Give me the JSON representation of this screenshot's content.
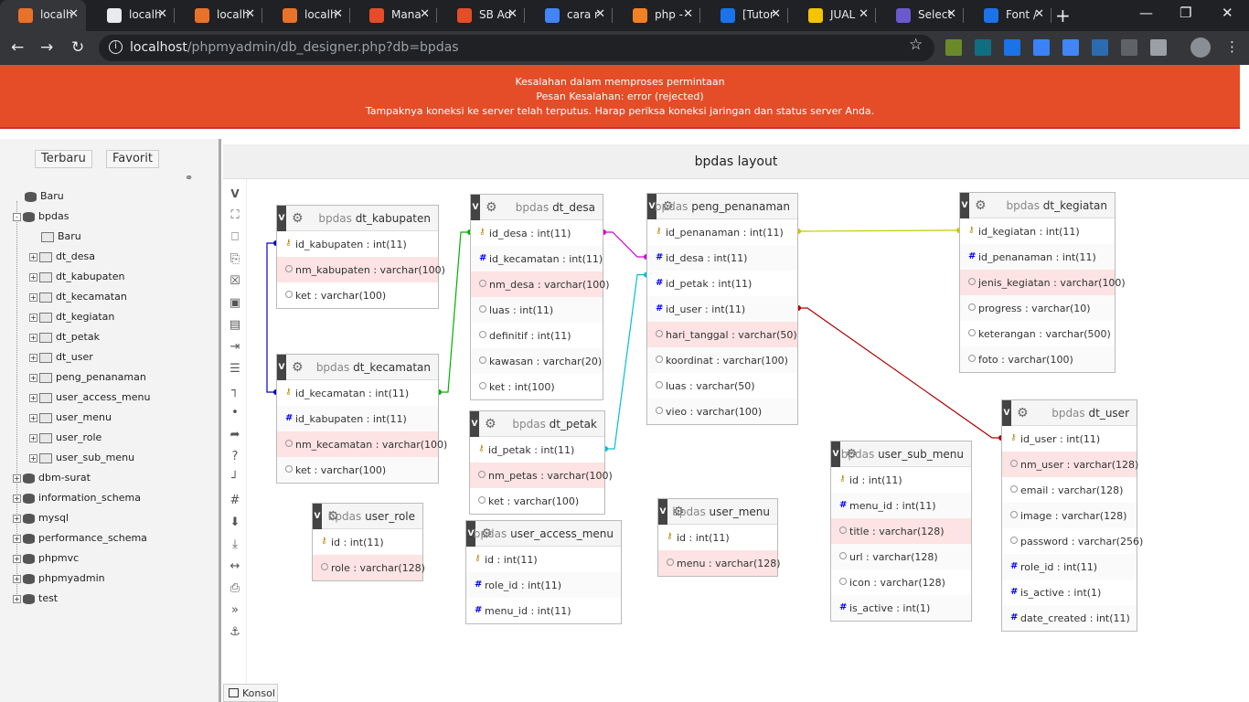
{
  "browser": {
    "tabs": [
      {
        "title": "localh",
        "icon": "phpmyadmin-icon",
        "active": true,
        "color": "#e8722a"
      },
      {
        "title": "localh",
        "icon": "loading-icon",
        "active": false,
        "color": "#e8eaed"
      },
      {
        "title": "localh",
        "icon": "phpmyadmin-icon",
        "active": false,
        "color": "#e8722a"
      },
      {
        "title": "localh",
        "icon": "phpmyadmin-icon",
        "active": false,
        "color": "#e8722a"
      },
      {
        "title": "Mana",
        "icon": "codeigniter-icon",
        "active": false,
        "color": "#e44d27"
      },
      {
        "title": "SB Ad",
        "icon": "codeigniter-icon",
        "active": false,
        "color": "#e44d27"
      },
      {
        "title": "cara r",
        "icon": "google-icon",
        "active": false,
        "color": "#4285f4"
      },
      {
        "title": "php -",
        "icon": "stackoverflow-icon",
        "active": false,
        "color": "#f48024"
      },
      {
        "title": "[Tutor",
        "icon": "tutorial-icon",
        "active": false,
        "color": "#1a73e8"
      },
      {
        "title": "JUAL",
        "icon": "hnd-icon",
        "active": false,
        "color": "#f5c400"
      },
      {
        "title": "Select",
        "icon": "select-icon",
        "active": false,
        "color": "#6a5acd"
      },
      {
        "title": "Font /",
        "icon": "flag-icon",
        "active": false,
        "color": "#1a73e8"
      }
    ],
    "url_host": "localhost",
    "url_path": "/phpmyadmin/db_designer.php?db=bpdas"
  },
  "error": {
    "line1": "Kesalahan dalam memproses permintaan",
    "line2": "Pesan Kesalahan: error (rejected)",
    "line3": "Tampaknya koneksi ke server telah terputus. Harap periksa koneksi jaringan dan status server Anda."
  },
  "leftpane": {
    "recent_label": "Terbaru",
    "favorite_label": "Favorit",
    "tree": [
      {
        "label": "Baru",
        "kind": "db",
        "indent": 0,
        "toggle": ""
      },
      {
        "label": "bpdas",
        "kind": "db",
        "indent": 0,
        "toggle": "-"
      },
      {
        "label": "Baru",
        "kind": "new",
        "indent": 1,
        "toggle": ""
      },
      {
        "label": "dt_desa",
        "kind": "table",
        "indent": 1,
        "toggle": "+"
      },
      {
        "label": "dt_kabupaten",
        "kind": "table",
        "indent": 1,
        "toggle": "+"
      },
      {
        "label": "dt_kecamatan",
        "kind": "table",
        "indent": 1,
        "toggle": "+"
      },
      {
        "label": "dt_kegiatan",
        "kind": "table",
        "indent": 1,
        "toggle": "+"
      },
      {
        "label": "dt_petak",
        "kind": "table",
        "indent": 1,
        "toggle": "+"
      },
      {
        "label": "dt_user",
        "kind": "table",
        "indent": 1,
        "toggle": "+"
      },
      {
        "label": "peng_penanaman",
        "kind": "table",
        "indent": 1,
        "toggle": "+"
      },
      {
        "label": "user_access_menu",
        "kind": "table",
        "indent": 1,
        "toggle": "+"
      },
      {
        "label": "user_menu",
        "kind": "table",
        "indent": 1,
        "toggle": "+"
      },
      {
        "label": "user_role",
        "kind": "table",
        "indent": 1,
        "toggle": "+"
      },
      {
        "label": "user_sub_menu",
        "kind": "table",
        "indent": 1,
        "toggle": "+"
      },
      {
        "label": "dbm-surat",
        "kind": "db",
        "indent": 0,
        "toggle": "+"
      },
      {
        "label": "information_schema",
        "kind": "db",
        "indent": 0,
        "toggle": "+"
      },
      {
        "label": "mysql",
        "kind": "db",
        "indent": 0,
        "toggle": "+"
      },
      {
        "label": "performance_schema",
        "kind": "db",
        "indent": 0,
        "toggle": "+"
      },
      {
        "label": "phpmvc",
        "kind": "db",
        "indent": 0,
        "toggle": "+"
      },
      {
        "label": "phpmyadmin",
        "kind": "db",
        "indent": 0,
        "toggle": "+"
      },
      {
        "label": "test",
        "kind": "db",
        "indent": 0,
        "toggle": "+"
      }
    ]
  },
  "designer": {
    "title": "bpdas layout",
    "toggle_label": "V",
    "console_label": "Konsol",
    "tables": [
      {
        "id": "dt_kabupaten",
        "db": "bpdas",
        "name": "dt_kabupaten",
        "cols": [
          {
            "t": "id_kabupaten : int(11)",
            "k": "key"
          },
          {
            "t": "nm_kabupaten : varchar(100)",
            "k": "text",
            "hl": true
          },
          {
            "t": "ket : varchar(100)",
            "k": "text"
          }
        ]
      },
      {
        "id": "dt_kecamatan",
        "db": "bpdas",
        "name": "dt_kecamatan",
        "cols": [
          {
            "t": "id_kecamatan : int(11)",
            "k": "key"
          },
          {
            "t": "id_kabupaten : int(11)",
            "k": "num"
          },
          {
            "t": "nm_kecamatan : varchar(100)",
            "k": "text",
            "hl": true
          },
          {
            "t": "ket : varchar(100)",
            "k": "text"
          }
        ]
      },
      {
        "id": "user_role",
        "db": "bpdas",
        "name": "user_role",
        "cols": [
          {
            "t": "id : int(11)",
            "k": "key"
          },
          {
            "t": "role : varchar(128)",
            "k": "text",
            "hl": true
          }
        ]
      },
      {
        "id": "dt_desa",
        "db": "bpdas",
        "name": "dt_desa",
        "cols": [
          {
            "t": "id_desa : int(11)",
            "k": "key"
          },
          {
            "t": "id_kecamatan : int(11)",
            "k": "num"
          },
          {
            "t": "nm_desa : varchar(100)",
            "k": "text",
            "hl": true
          },
          {
            "t": "luas : int(11)",
            "k": "text"
          },
          {
            "t": "definitif : int(11)",
            "k": "text"
          },
          {
            "t": "kawasan : varchar(20)",
            "k": "text"
          },
          {
            "t": "ket : int(100)",
            "k": "text"
          }
        ]
      },
      {
        "id": "dt_petak",
        "db": "bpdas",
        "name": "dt_petak",
        "cols": [
          {
            "t": "id_petak : int(11)",
            "k": "key"
          },
          {
            "t": "nm_petas : varchar(100)",
            "k": "text",
            "hl": true
          },
          {
            "t": "ket : varchar(100)",
            "k": "text"
          }
        ]
      },
      {
        "id": "user_access_menu",
        "db": "bpdas",
        "name": "user_access_menu",
        "cols": [
          {
            "t": "id : int(11)",
            "k": "key"
          },
          {
            "t": "role_id : int(11)",
            "k": "num"
          },
          {
            "t": "menu_id : int(11)",
            "k": "num"
          }
        ]
      },
      {
        "id": "peng_penanaman",
        "db": "bpdas",
        "name": "peng_penanaman",
        "cols": [
          {
            "t": "id_penanaman : int(11)",
            "k": "key"
          },
          {
            "t": "id_desa : int(11)",
            "k": "num"
          },
          {
            "t": "id_petak : int(11)",
            "k": "num"
          },
          {
            "t": "id_user : int(11)",
            "k": "num"
          },
          {
            "t": "hari_tanggal : varchar(50)",
            "k": "text",
            "hl": true
          },
          {
            "t": "koordinat : varchar(100)",
            "k": "text"
          },
          {
            "t": "luas : varchar(50)",
            "k": "text"
          },
          {
            "t": "vieo : varchar(100)",
            "k": "text"
          }
        ]
      },
      {
        "id": "user_menu",
        "db": "bpdas",
        "name": "user_menu",
        "cols": [
          {
            "t": "id : int(11)",
            "k": "key"
          },
          {
            "t": "menu : varchar(128)",
            "k": "text",
            "hl": true
          }
        ]
      },
      {
        "id": "user_sub_menu",
        "db": "bpdas",
        "name": "user_sub_menu",
        "cols": [
          {
            "t": "id : int(11)",
            "k": "key"
          },
          {
            "t": "menu_id : int(11)",
            "k": "num"
          },
          {
            "t": "title : varchar(128)",
            "k": "text",
            "hl": true
          },
          {
            "t": "url : varchar(128)",
            "k": "text"
          },
          {
            "t": "icon : varchar(128)",
            "k": "text"
          },
          {
            "t": "is_active : int(1)",
            "k": "num"
          }
        ]
      },
      {
        "id": "dt_kegiatan",
        "db": "bpdas",
        "name": "dt_kegiatan",
        "cols": [
          {
            "t": "id_kegiatan : int(11)",
            "k": "key"
          },
          {
            "t": "id_penanaman : int(11)",
            "k": "num"
          },
          {
            "t": "jenis_kegiatan : varchar(100)",
            "k": "text",
            "hl": true
          },
          {
            "t": "progress : varchar(10)",
            "k": "text"
          },
          {
            "t": "keterangan : varchar(500)",
            "k": "text"
          },
          {
            "t": "foto : varchar(100)",
            "k": "text"
          }
        ]
      },
      {
        "id": "dt_user",
        "db": "bpdas",
        "name": "dt_user",
        "cols": [
          {
            "t": "id_user : int(11)",
            "k": "key"
          },
          {
            "t": "nm_user : varchar(128)",
            "k": "text",
            "hl": true
          },
          {
            "t": "email : varchar(128)",
            "k": "text"
          },
          {
            "t": "image : varchar(128)",
            "k": "text"
          },
          {
            "t": "password : varchar(256)",
            "k": "text"
          },
          {
            "t": "role_id : int(11)",
            "k": "num"
          },
          {
            "t": "is_active : int(1)",
            "k": "num"
          },
          {
            "t": "date_created : int(11)",
            "k": "num"
          }
        ]
      }
    ],
    "relations": [
      {
        "from": "dt_kecamatan",
        "to": "dt_kabupaten",
        "color": "#0000c0"
      },
      {
        "from": "dt_desa",
        "to": "dt_kecamatan",
        "color": "#00b000"
      },
      {
        "from": "peng_penanaman",
        "to": "dt_desa",
        "color": "#d000d0"
      },
      {
        "from": "peng_penanaman",
        "to": "dt_petak",
        "color": "#00c0d0"
      },
      {
        "from": "dt_kegiatan",
        "to": "peng_penanaman",
        "color": "#c8c800"
      },
      {
        "from": "peng_penanaman",
        "to": "dt_user",
        "color": "#b00000"
      }
    ],
    "tools": [
      "fullscreen-icon",
      "new-page-icon",
      "open-page-icon",
      "delete-page-icon",
      "save-icon",
      "save-as-icon",
      "export-icon",
      "table-list-icon",
      "relation-line-icon",
      "point-icon",
      "redirect-icon",
      "help-icon",
      "angular-links-icon",
      "grid-icon",
      "collapse-all-icon",
      "download-icon",
      "hide-icon",
      "pdf-icon",
      "more-icon",
      "anchor-icon"
    ]
  }
}
